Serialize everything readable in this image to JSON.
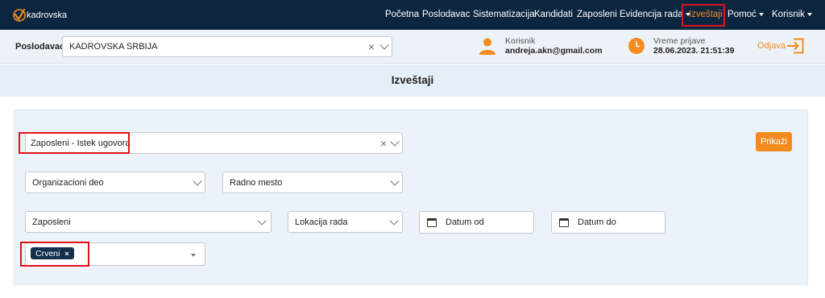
{
  "brand": {
    "name": "kadrovska"
  },
  "nav": {
    "items": [
      {
        "label": "Početna"
      },
      {
        "label": "Poslodavac"
      },
      {
        "label": "Sistematizacija"
      },
      {
        "label": "Kandidati"
      },
      {
        "label": "Zaposleni"
      },
      {
        "label": "Evidencija rada"
      },
      {
        "label": "Izveštaji"
      },
      {
        "label": "Pomoć"
      },
      {
        "label": "Korisnik"
      }
    ]
  },
  "employer": {
    "label": "Poslodavac",
    "value": "KADROVSKA SRBIJA"
  },
  "user": {
    "label": "Korisnik",
    "value": "andreja.akn@gmail.com"
  },
  "login_time": {
    "label": "Vreme prijave",
    "value": "28.06.2023. 21:51:39"
  },
  "logout": {
    "label": "Odjava"
  },
  "page": {
    "title": "Izveštaji"
  },
  "filters": {
    "report_type": "Zaposleni - Istek ugovora",
    "org_unit": "Organizacioni deo",
    "position": "Radno mesto",
    "employees": "Zaposleni",
    "work_location": "Lokacija rada",
    "date_from": "Datum od",
    "date_to": "Datum do",
    "tag": "Crveni"
  },
  "actions": {
    "show": "Prikaži"
  },
  "colors": {
    "navbar": "#0d2640",
    "accent": "#f38b1f",
    "highlight": "#e0121b"
  }
}
